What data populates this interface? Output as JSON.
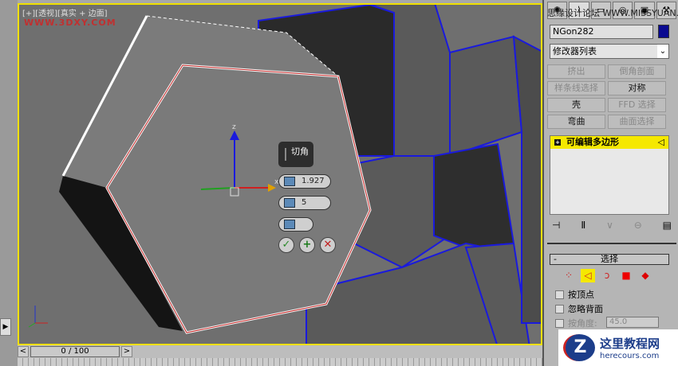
{
  "viewport": {
    "label": "[+][透视][真实 + 边面]",
    "watermark": "WWW.3DXY.COM",
    "axis_z": "z",
    "axis_x": "x"
  },
  "caddy": {
    "title": "切角",
    "amount": "1.927",
    "segments": "5",
    "ok": "✓",
    "apply": "+",
    "cancel": "✕"
  },
  "timeline": {
    "position": "0 / 100",
    "prev": "<",
    "next": ">"
  },
  "panel": {
    "tabs": [
      "✺",
      "⌇",
      "▭",
      "◎",
      "▣",
      "⚒"
    ],
    "forum_watermark": "思缘设计论坛 WWW.MISSYUAN.COM",
    "object_name": "NGon282",
    "object_color": "#0a0a90",
    "modifier_list": "修改器列表",
    "buttons": [
      {
        "label": "挤出",
        "on": false
      },
      {
        "label": "倒角剖面",
        "on": false
      },
      {
        "label": "样条线选择",
        "on": false
      },
      {
        "label": "对称",
        "on": true
      },
      {
        "label": "壳",
        "on": true
      },
      {
        "label": "FFD 选择",
        "on": false
      },
      {
        "label": "弯曲",
        "on": true
      },
      {
        "label": "曲面选择",
        "on": false
      }
    ],
    "stack_item": "可编辑多边形",
    "rollout_title": "选择",
    "checkboxes": [
      "按顶点",
      "忽略背面",
      "按角度:"
    ],
    "angle_value": "45.0"
  },
  "logo": {
    "name": "这里教程网",
    "url": "herecours.com"
  }
}
